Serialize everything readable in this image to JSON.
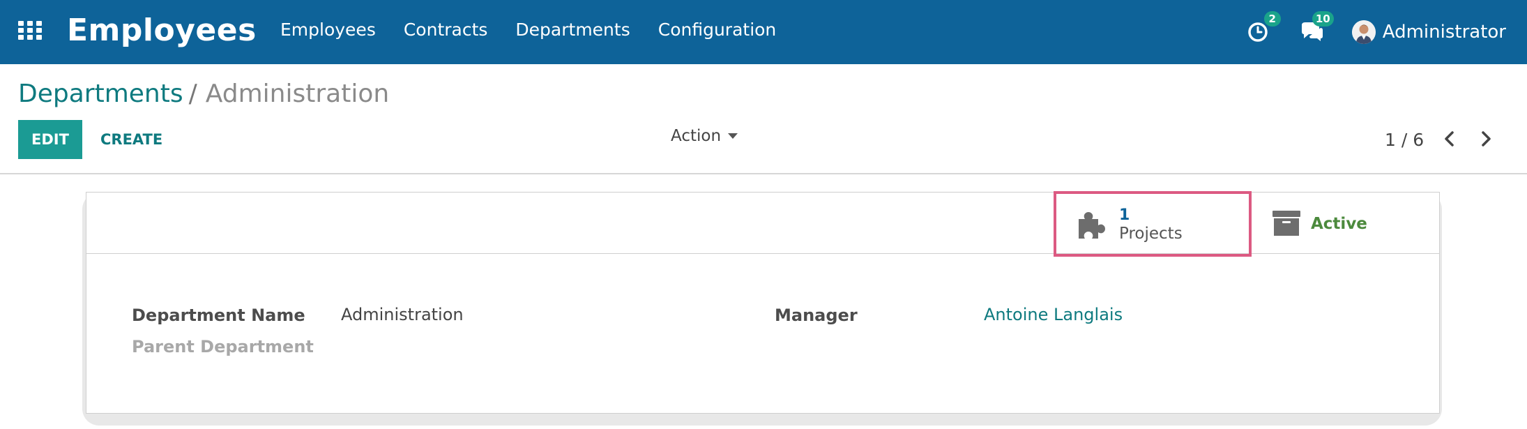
{
  "navbar": {
    "app_title": "Employees",
    "menu": [
      "Employees",
      "Contracts",
      "Departments",
      "Configuration"
    ],
    "activity_count": "2",
    "messages_count": "10",
    "user_name": "Administrator",
    "icons": [
      "apps-grid-icon",
      "clock-icon",
      "chat-icon",
      "avatar"
    ]
  },
  "breadcrumb": {
    "parent": "Departments",
    "separator": "/",
    "current": "Administration"
  },
  "toolbar": {
    "edit_label": "EDIT",
    "create_label": "CREATE",
    "action_label": "Action",
    "pager_text": "1 / 6"
  },
  "smart_buttons": {
    "projects_count": "1",
    "projects_label": "Projects",
    "active_label": "Active"
  },
  "form": {
    "department_name_label": "Department Name",
    "department_name_value": "Administration",
    "parent_department_label": "Parent Department",
    "manager_label": "Manager",
    "manager_value": "Antoine Langlais"
  },
  "colors": {
    "navbar": "#0e6399",
    "primary": "#1b9b94",
    "link": "#0e7a7f",
    "badge": "#1aa38a",
    "highlight_border": "#dc5a82",
    "active_green": "#4c8a3d"
  }
}
